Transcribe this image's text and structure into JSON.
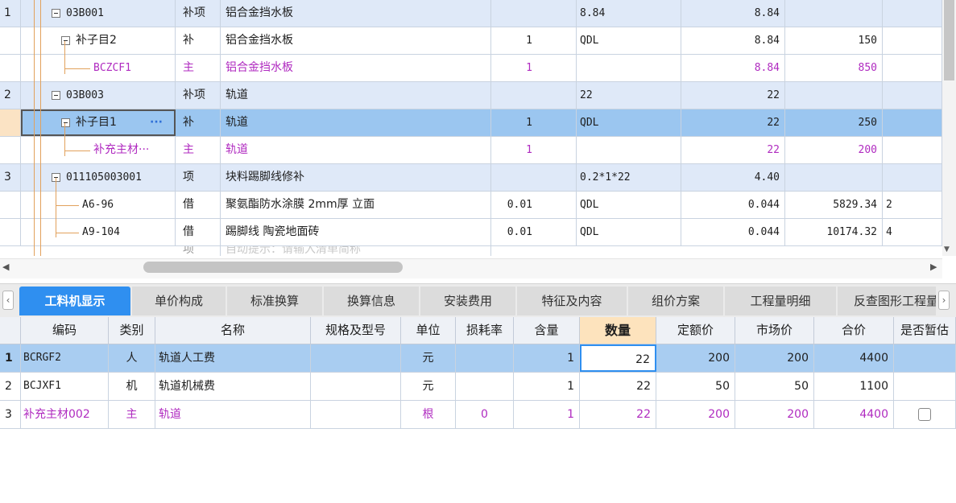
{
  "top_rows": [
    {
      "index": "1",
      "code": "03B001",
      "type": "补项",
      "name": "铝合金挡水板",
      "qty_factor": "",
      "unit": "8.84",
      "qty": "8.84",
      "price": "",
      "total": ""
    },
    {
      "index": "",
      "code": "补子目2",
      "type": "补",
      "name": "铝合金挡水板",
      "qty_factor": "1",
      "unit": "QDL",
      "qty": "8.84",
      "price": "150",
      "total": ""
    },
    {
      "index": "",
      "code": "BCZCF1",
      "type": "主",
      "name": "铝合金挡水板",
      "qty_factor": "1",
      "unit": "",
      "qty": "8.84",
      "price": "850",
      "total": ""
    },
    {
      "index": "2",
      "code": "03B003",
      "type": "补项",
      "name": "轨道",
      "qty_factor": "",
      "unit": "22",
      "qty": "22",
      "price": "",
      "total": ""
    },
    {
      "index": "",
      "code": "补子目1",
      "type": "补",
      "name": "轨道",
      "qty_factor": "1",
      "unit": "QDL",
      "qty": "22",
      "price": "250",
      "total": "",
      "more": "···"
    },
    {
      "index": "",
      "code": "补充主材···",
      "type": "主",
      "name": "轨道",
      "qty_factor": "1",
      "unit": "",
      "qty": "22",
      "price": "200",
      "total": ""
    },
    {
      "index": "3",
      "code": "011105003001",
      "type": "项",
      "name": "块料踢脚线修补",
      "qty_factor": "",
      "unit": "0.2*1*22",
      "qty": "4.40",
      "price": "",
      "total": ""
    },
    {
      "index": "",
      "code": "A6-96",
      "type": "借",
      "name": "聚氨酯防水涂膜 2mm厚 立面",
      "qty_factor": "0.01",
      "unit": "QDL",
      "qty": "0.044",
      "price": "5829.34",
      "total": "2"
    },
    {
      "index": "",
      "code": "A9-104",
      "type": "借",
      "name": "踢脚线 陶瓷地面砖",
      "qty_factor": "0.01",
      "unit": "QDL",
      "qty": "0.044",
      "price": "10174.32",
      "total": "4"
    }
  ],
  "partial_row": {
    "type": "项",
    "name": "自动提示：请输入清单简称"
  },
  "tabs": [
    "工料机显示",
    "单价构成",
    "标准换算",
    "换算信息",
    "安装费用",
    "特征及内容",
    "组价方案",
    "工程量明细",
    "反查图形工程量"
  ],
  "tab_nav": {
    "left": "‹",
    "right": "›"
  },
  "columns": [
    "编码",
    "类别",
    "名称",
    "规格及型号",
    "单位",
    "损耗率",
    "含量",
    "数量",
    "定额价",
    "市场价",
    "合价",
    "是否暂估"
  ],
  "rows": [
    {
      "index": "1",
      "code": "BCRGF2",
      "type": "人",
      "name": "轨道人工费",
      "spec": "",
      "unit": "元",
      "loss": "",
      "content": "1",
      "qty": "22",
      "fixed_price": "200",
      "market_price": "200",
      "total": "4400",
      "temp": ""
    },
    {
      "index": "2",
      "code": "BCJXF1",
      "type": "机",
      "name": "轨道机械费",
      "spec": "",
      "unit": "元",
      "loss": "",
      "content": "1",
      "qty": "22",
      "fixed_price": "50",
      "market_price": "50",
      "total": "1100",
      "temp": ""
    },
    {
      "index": "3",
      "code": "补充主材002",
      "type": "主",
      "name": "轨道",
      "spec": "",
      "unit": "根",
      "loss": "0",
      "content": "1",
      "qty": "22",
      "fixed_price": "200",
      "market_price": "200",
      "total": "4400",
      "temp": "checkbox"
    }
  ],
  "scroll": {
    "left": "◀",
    "right": "▶",
    "down": "▼"
  },
  "colors": {
    "accent": "#2f8ff0",
    "main_material": "#b02bc0",
    "tree_line": "#e2a15c",
    "selected_row": "#9bc6f0",
    "parent_row": "#dfe9f8"
  }
}
